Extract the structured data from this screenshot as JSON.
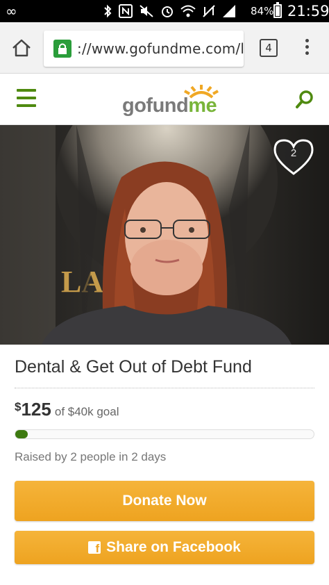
{
  "status_bar": {
    "left_icon": "infinity-icon",
    "battery_percent": "84%",
    "time": "21:59"
  },
  "browser": {
    "url": "://www.gofundme.com/l",
    "tab_count": "4"
  },
  "site": {
    "logo_text_a": "gofund",
    "logo_text_b": "me"
  },
  "campaign": {
    "favorite_count": "2",
    "title": "Dental & Get Out of Debt Fund",
    "currency_symbol": "$",
    "raised_amount": "125",
    "goal_text": "of $40k goal",
    "progress_fraction": 0.003,
    "raised_by_text": "Raised by 2 people in 2 days",
    "donate_label": "Donate Now",
    "share_label": "Share on Facebook",
    "share_icon_glyph": "f"
  },
  "colors": {
    "brand_green": "#4f8a10",
    "progress_green": "#3d7a10",
    "button_orange": "#eea320"
  }
}
